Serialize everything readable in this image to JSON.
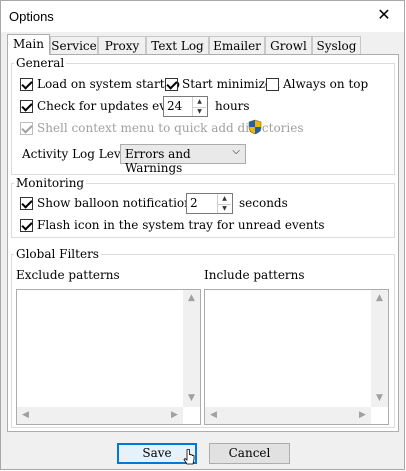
{
  "window": {
    "title": "Options",
    "close_glyph": "✕"
  },
  "tabs": [
    {
      "label": "Main",
      "active": true
    },
    {
      "label": "Service"
    },
    {
      "label": "Proxy"
    },
    {
      "label": "Text Log"
    },
    {
      "label": "Emailer"
    },
    {
      "label": "Growl"
    },
    {
      "label": "Syslog"
    }
  ],
  "general": {
    "title": "General",
    "load_on_startup": {
      "label": "Load on system startup",
      "checked": true
    },
    "start_minimized": {
      "label": "Start minimized",
      "checked": true
    },
    "always_on_top": {
      "label": "Always on top",
      "checked": false
    },
    "check_updates": {
      "label": "Check for updates every",
      "checked": true,
      "value": "24",
      "unit": "hours"
    },
    "shell_context": {
      "label": "Shell context menu to quick add directories",
      "checked": true,
      "disabled": true,
      "icon": "uac-shield-icon"
    },
    "activity_log": {
      "label": "Activity Log Level:",
      "value": "Errors and  Warnings"
    }
  },
  "monitoring": {
    "title": "Monitoring",
    "balloon": {
      "label": "Show balloon notifications for",
      "checked": true,
      "value": "2",
      "unit": "seconds"
    },
    "flash_icon": {
      "label": "Flash icon in the system tray for unread events",
      "checked": true
    }
  },
  "filters": {
    "title": "Global Filters",
    "exclude_label": "Exclude patterns",
    "include_label": "Include patterns",
    "exclude_value": "",
    "include_value": ""
  },
  "footer": {
    "save_label": "Save",
    "cancel_label": "Cancel"
  },
  "colors": {
    "accent": "#0078d7",
    "shield_blue": "#1e5fb4",
    "shield_gold": "#f2b600"
  }
}
